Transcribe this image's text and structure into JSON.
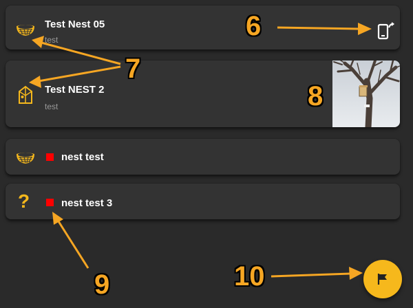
{
  "nests": [
    {
      "title": "Test Nest 05",
      "subtitle": "test",
      "icon": "bowl-nest-icon"
    },
    {
      "title": "Test NEST 2",
      "subtitle": "test",
      "icon": "nest-box-icon",
      "has_photo": true
    },
    {
      "title": "nest test",
      "icon": "bowl-nest-icon",
      "status": "red-square"
    },
    {
      "title": "nest test 3",
      "icon": "question-icon",
      "status": "red-square",
      "icon_text": "?"
    }
  ],
  "annotations": {
    "n6": "6",
    "n7": "7",
    "n8": "8",
    "n9": "9",
    "n10": "10"
  },
  "colors": {
    "accent": "#f6b81c",
    "status": "#ff0000",
    "card": "#333333",
    "background": "#2a2a2a"
  },
  "icons": {
    "sync": "phone-sync-icon",
    "fab": "flag-icon"
  }
}
